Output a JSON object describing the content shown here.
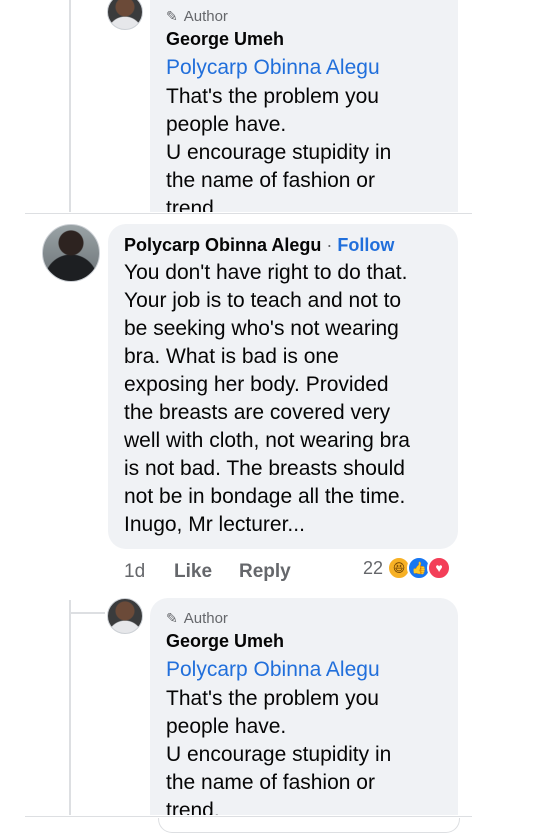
{
  "top_reply": {
    "author_tag": "Author",
    "name": "George Umeh",
    "mention": "Polycarp Obinna Alegu",
    "text": "That's the problem you\npeople have.\nU encourage stupidity in\nthe name of fashion or\ntrend."
  },
  "main_comment": {
    "name": "Polycarp Obinna Alegu",
    "follow_sep": " · ",
    "follow": "Follow",
    "text": "You don't have right to do that.\nYour job is to teach and not to\nbe seeking who's not wearing\nbra. What is bad is one\nexposing her body. Provided\nthe breasts are covered very\nwell with cloth, not wearing bra\nis not bad. The breasts should\nnot be in bondage all the time.\nInugo, Mr lecturer...",
    "time": "1d",
    "like_label": "Like",
    "reply_label": "Reply",
    "reaction_count": "22",
    "reactions": [
      "haha-icon",
      "like-icon",
      "love-icon"
    ]
  },
  "bottom_reply": {
    "author_tag": "Author",
    "name": "George Umeh",
    "mention": "Polycarp Obinna Alegu",
    "text": "That's the problem you\npeople have.\nU encourage stupidity in\nthe name of fashion or\ntrend."
  },
  "colors": {
    "link": "#216fdb",
    "bubble": "#f0f2f5",
    "secondary_text": "#65676b"
  }
}
